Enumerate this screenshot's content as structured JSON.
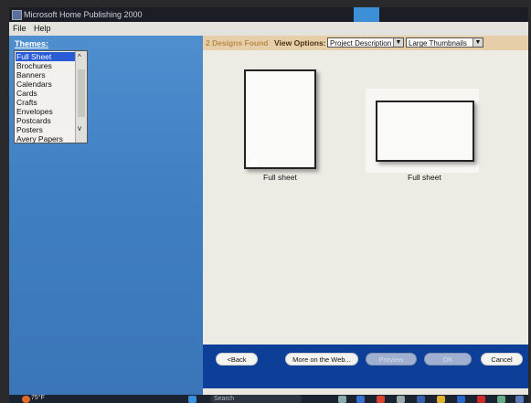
{
  "window": {
    "title": "Microsoft Home Publishing 2000",
    "accent_color": "#3d8fd8"
  },
  "menu": [
    "File",
    "Help"
  ],
  "themes": {
    "label": "Themes:",
    "items": [
      "Full Sheet",
      "Brochures",
      "Banners",
      "Calendars",
      "Cards",
      "Crafts",
      "Envelopes",
      "Postcards",
      "Posters",
      "Avery Papers"
    ],
    "selected": "Full Sheet",
    "selection_color": "#2a5bd6"
  },
  "toolbar": {
    "found_text": "2  Designs Found",
    "view_options_label": "View Options:",
    "sort_select": "Project Description",
    "size_select": "Large Thumbnails"
  },
  "designs": [
    {
      "caption": "Full sheet",
      "orientation": "portrait"
    },
    {
      "caption": "Full sheet",
      "orientation": "landscape"
    }
  ],
  "buttons": {
    "back": "<Back",
    "more": "More on the Web...",
    "preview": "Preview",
    "ok": "OK",
    "cancel": "Cancel"
  },
  "taskbar": {
    "weather": "75°F",
    "search": "Search"
  },
  "colors": {
    "left_panel": "#3f7fc2",
    "bottom_bar": "#0e3f98",
    "toolbar": "#e6cfa8"
  }
}
